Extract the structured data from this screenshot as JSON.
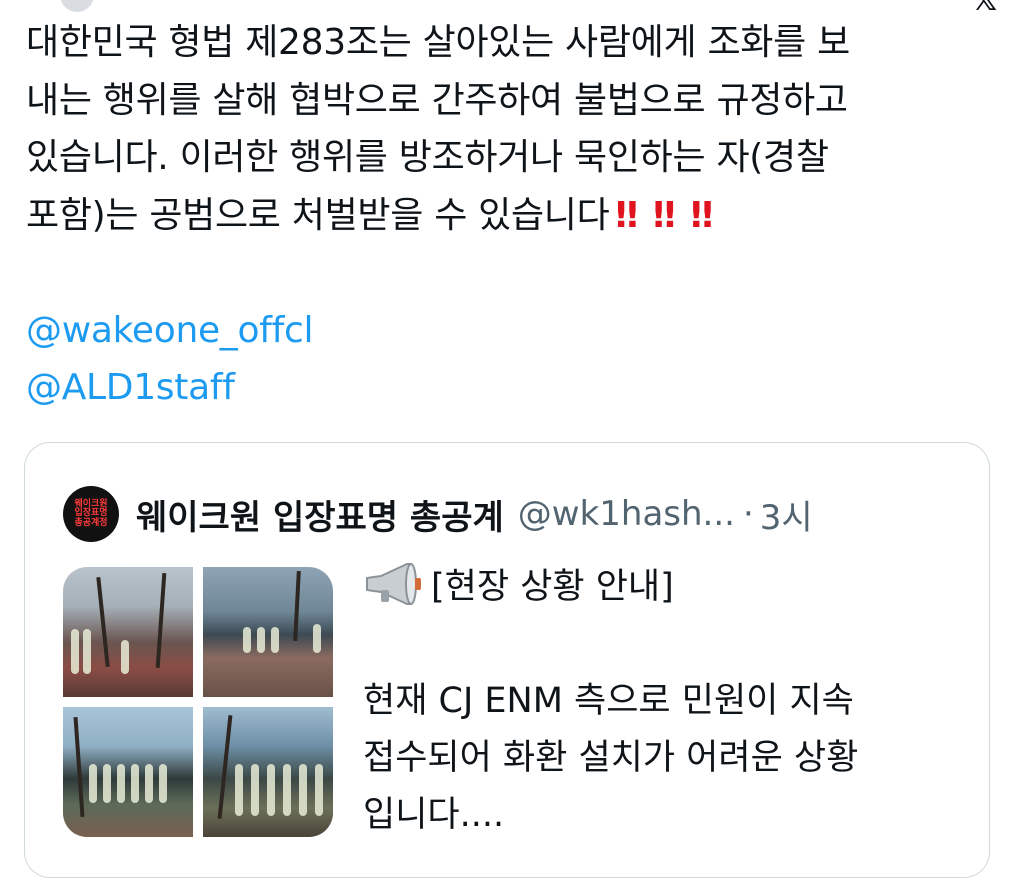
{
  "main_tweet": {
    "lines": [
      "대한민국 형법 제283조는 살아있는 사람에게 조화를 보",
      "내는 행위를 살해 협박으로 간주하여 불법으로 규정하고",
      "있습니다. 이러한 행위를 방조하거나 묵인하는 자(경찰",
      "포함)는 공범으로 처벌받을 수 있습니다"
    ],
    "emphasis": [
      "‼",
      "‼",
      "‼"
    ],
    "mentions": [
      "@wakeone_offcl",
      "@ALD1staff"
    ]
  },
  "quote_tweet": {
    "avatar_lines": [
      "웨이크원",
      "입장표명",
      "총공계정"
    ],
    "display_name": "웨이크원 입장표명 총공계",
    "handle": "@wk1hash...",
    "separator": "·",
    "time": "3시",
    "text_lines": [
      "[현장 상황 안내]",
      "현재 CJ ENM 측으로 민원이 지속",
      "접수되어 화환 설치가 어려운 상황",
      "입니다...."
    ],
    "megaphone_icon": "megaphone-icon",
    "image_count": 4
  },
  "colors": {
    "text": "#0f1419",
    "secondary": "#536471",
    "link": "#1d9bf0",
    "emphasis": "#e0141e",
    "border": "#cfd9de"
  }
}
